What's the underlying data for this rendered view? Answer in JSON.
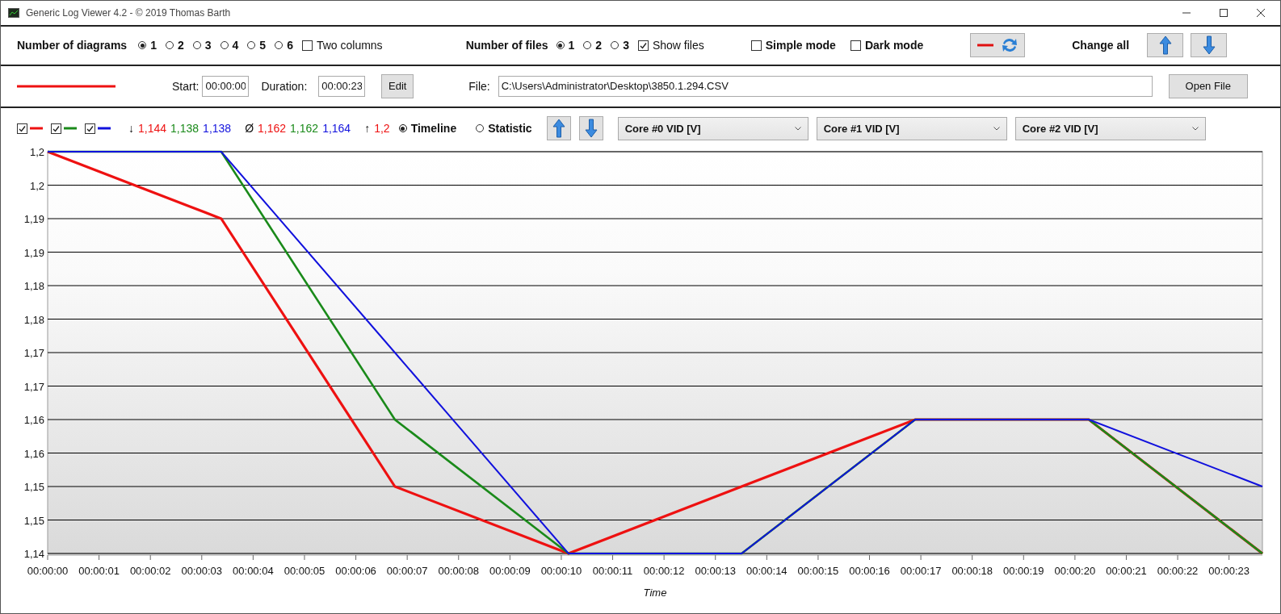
{
  "window": {
    "title": "Generic Log Viewer 4.2 - © 2019 Thomas Barth"
  },
  "toolbar": {
    "diagrams_label": "Number of diagrams",
    "diagrams": [
      {
        "label": "1",
        "selected": true
      },
      {
        "label": "2",
        "selected": false
      },
      {
        "label": "3",
        "selected": false
      },
      {
        "label": "4",
        "selected": false
      },
      {
        "label": "5",
        "selected": false
      },
      {
        "label": "6",
        "selected": false
      }
    ],
    "two_columns": {
      "label": "Two columns",
      "checked": false
    },
    "files_label": "Number of files",
    "files": [
      {
        "label": "1",
        "selected": true
      },
      {
        "label": "2",
        "selected": false
      },
      {
        "label": "3",
        "selected": false
      }
    ],
    "show_files": {
      "label": "Show files",
      "checked": true
    },
    "simple_mode": {
      "label": "Simple mode",
      "checked": false
    },
    "dark_mode": {
      "label": "Dark mode",
      "checked": false
    },
    "change_all": "Change all"
  },
  "file_row": {
    "start_label": "Start:",
    "start": "00:00:00",
    "duration_label": "Duration:",
    "duration": "00:00:23",
    "edit": "Edit",
    "file_label": "File:",
    "file": "C:\\Users\\Administrator\\Desktop\\3850.1.294.CSV",
    "open": "Open File"
  },
  "legend": [
    {
      "checked": true,
      "color": "#ee1111"
    },
    {
      "checked": true,
      "color": "#1a8a1a"
    },
    {
      "checked": true,
      "color": "#1111dd"
    }
  ],
  "stats": [
    {
      "symbol": "↓",
      "values": [
        "1,144",
        "1,138",
        "1,138"
      ]
    },
    {
      "symbol": "Ø",
      "values": [
        "1,162",
        "1,162",
        "1,164"
      ]
    },
    {
      "symbol": "↑",
      "values": [
        "1,2"
      ]
    }
  ],
  "view_modes": [
    {
      "label": "Timeline",
      "selected": true
    },
    {
      "label": "Statistic",
      "selected": false
    }
  ],
  "channels": [
    {
      "value": "Core #0 VID [V]"
    },
    {
      "value": "Core #1 VID [V]"
    },
    {
      "value": "Core #2 VID [V]"
    }
  ],
  "chart_data": {
    "type": "line",
    "grid": true,
    "xlabel": "Time",
    "x": [
      0,
      3.38,
      6.76,
      10.14,
      13.51,
      16.89,
      20.27,
      23.65
    ],
    "xlim": [
      0,
      23.65
    ],
    "ylim": [
      1.14,
      1.2
    ],
    "xticks": [
      {
        "value": 0,
        "label": "00:00:00"
      },
      {
        "value": 1,
        "label": "00:00:01"
      },
      {
        "value": 2,
        "label": "00:00:02"
      },
      {
        "value": 3,
        "label": "00:00:03"
      },
      {
        "value": 4,
        "label": "00:00:04"
      },
      {
        "value": 5,
        "label": "00:00:05"
      },
      {
        "value": 6,
        "label": "00:00:06"
      },
      {
        "value": 7,
        "label": "00:00:07"
      },
      {
        "value": 8,
        "label": "00:00:08"
      },
      {
        "value": 9,
        "label": "00:00:09"
      },
      {
        "value": 10,
        "label": "00:00:10"
      },
      {
        "value": 11,
        "label": "00:00:11"
      },
      {
        "value": 12,
        "label": "00:00:12"
      },
      {
        "value": 13,
        "label": "00:00:13"
      },
      {
        "value": 14,
        "label": "00:00:14"
      },
      {
        "value": 15,
        "label": "00:00:15"
      },
      {
        "value": 16,
        "label": "00:00:16"
      },
      {
        "value": 17,
        "label": "00:00:17"
      },
      {
        "value": 18,
        "label": "00:00:18"
      },
      {
        "value": 19,
        "label": "00:00:19"
      },
      {
        "value": 20,
        "label": "00:00:20"
      },
      {
        "value": 21,
        "label": "00:00:21"
      },
      {
        "value": 22,
        "label": "00:00:22"
      },
      {
        "value": 23,
        "label": "00:00:23"
      }
    ],
    "yticks": [
      {
        "value": 1.2,
        "label": "1,2"
      },
      {
        "value": 1.195,
        "label": "1,2"
      },
      {
        "value": 1.19,
        "label": "1,19"
      },
      {
        "value": 1.185,
        "label": "1,19"
      },
      {
        "value": 1.18,
        "label": "1,18"
      },
      {
        "value": 1.175,
        "label": "1,18"
      },
      {
        "value": 1.17,
        "label": "1,17"
      },
      {
        "value": 1.165,
        "label": "1,17"
      },
      {
        "value": 1.16,
        "label": "1,16"
      },
      {
        "value": 1.155,
        "label": "1,16"
      },
      {
        "value": 1.15,
        "label": "1,15"
      },
      {
        "value": 1.145,
        "label": "1,15"
      },
      {
        "value": 1.14,
        "label": "1,14"
      }
    ],
    "series": [
      {
        "color": "#ee1111",
        "values": [
          1.2,
          1.19,
          1.15,
          1.14,
          1.15,
          1.16,
          1.16,
          1.14
        ]
      },
      {
        "color": "#1a8a1a",
        "values": [
          1.2,
          1.2,
          1.16,
          1.14,
          1.14,
          1.16,
          1.16,
          1.14
        ]
      },
      {
        "color": "#1111dd",
        "values": [
          1.2,
          1.2,
          1.17,
          1.14,
          1.14,
          1.16,
          1.16,
          1.15
        ]
      }
    ]
  }
}
